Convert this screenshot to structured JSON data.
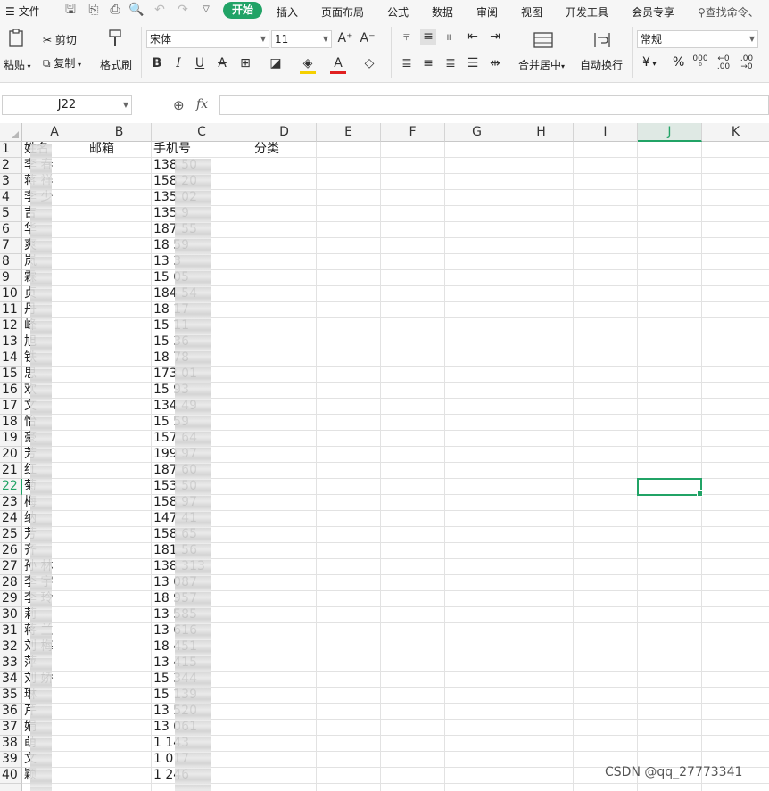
{
  "menu": {
    "file": "文件",
    "tabs": [
      "开始",
      "插入",
      "页面布局",
      "公式",
      "数据",
      "审阅",
      "视图",
      "开发工具",
      "会员专享"
    ],
    "search": "查找命令、"
  },
  "ribbon": {
    "paste": "粘贴",
    "cut": "剪切",
    "copy": "复制",
    "format_painter": "格式刷",
    "font_name": "宋体",
    "font_size": "11",
    "merge_center": "合并居中",
    "wrap_text": "自动换行",
    "number_format": "常规",
    "currency_symbol": "¥",
    "percent_symbol": "%"
  },
  "formula_bar": {
    "cell_ref": "J22",
    "fx": "fx",
    "value": ""
  },
  "sheet": {
    "columns": [
      "A",
      "B",
      "C",
      "D",
      "E",
      "F",
      "G",
      "H",
      "I",
      "J",
      "K"
    ],
    "selected_column": "J",
    "selected_row": 22,
    "headers": {
      "A": "姓名",
      "B": "邮箱",
      "C": "手机号",
      "D": "分类"
    },
    "rows": [
      {
        "n": 2,
        "a": "李 春",
        "c": "138 50"
      },
      {
        "n": 3,
        "a": "蒋 祥",
        "c": "158 20"
      },
      {
        "n": 4,
        "a": "李 少",
        "c": "135 02"
      },
      {
        "n": 5,
        "a": "  吉",
        "c": "135 9"
      },
      {
        "n": 6,
        "a": "  华",
        "c": "187 55"
      },
      {
        "n": 7,
        "a": "  爽",
        "c": "18 59"
      },
      {
        "n": 8,
        "a": "  岚",
        "c": "13 3"
      },
      {
        "n": 9,
        "a": "  霖",
        "c": "15 05"
      },
      {
        "n": 10,
        "a": "  贞",
        "c": "184 54"
      },
      {
        "n": 11,
        "a": "  丹",
        "c": "18 17"
      },
      {
        "n": 12,
        "a": "  峰",
        "c": "15 11"
      },
      {
        "n": 13,
        "a": "  旭",
        "c": "15 36"
      },
      {
        "n": 14,
        "a": "  铁",
        "c": "18 78"
      },
      {
        "n": 15,
        "a": "  思",
        "c": "173 01"
      },
      {
        "n": 16,
        "a": "  欢",
        "c": "15 93"
      },
      {
        "n": 17,
        "a": "  文",
        "c": "134 49"
      },
      {
        "n": 18,
        "a": "  怡",
        "c": "15 59"
      },
      {
        "n": 19,
        "a": "  豪",
        "c": "157 64"
      },
      {
        "n": 20,
        "a": "  芳",
        "c": "199 97"
      },
      {
        "n": 21,
        "a": "  红",
        "c": "187 60"
      },
      {
        "n": 22,
        "a": "  菊",
        "c": "153 50"
      },
      {
        "n": 23,
        "a": "  梅",
        "c": "158 97"
      },
      {
        "n": 24,
        "a": "  纳",
        "c": "147 41"
      },
      {
        "n": 25,
        "a": "  芳",
        "c": "158 65"
      },
      {
        "n": 26,
        "a": "  齐",
        "c": "181 56"
      },
      {
        "n": 27,
        "a": "孙 林",
        "c": "138 313"
      },
      {
        "n": 28,
        "a": "李 宇",
        "c": "13 087"
      },
      {
        "n": 29,
        "a": "李 玲",
        "c": "18 957"
      },
      {
        "n": 30,
        "a": "  莉",
        "c": "13 585"
      },
      {
        "n": 31,
        "a": "蒋 兰",
        "c": "13 616"
      },
      {
        "n": 32,
        "a": "刘 梅",
        "c": "18 451"
      },
      {
        "n": 33,
        "a": "  萍",
        "c": "13 415"
      },
      {
        "n": 34,
        "a": "刘 娇",
        "c": "15 344"
      },
      {
        "n": 35,
        "a": "  琳",
        "c": "15 139"
      },
      {
        "n": 36,
        "a": "  芹",
        "c": "13 520"
      },
      {
        "n": 37,
        "a": "  娟",
        "c": "13 061"
      },
      {
        "n": 38,
        "a": "  萌",
        "c": "1 143"
      },
      {
        "n": 39,
        "a": "  文",
        "c": "1 017"
      },
      {
        "n": 40,
        "a": "  颖",
        "c": "1 246"
      }
    ]
  },
  "watermark": "CSDN @qq_27773341",
  "colors": {
    "accent": "#21a366",
    "selection": "#21a366"
  }
}
